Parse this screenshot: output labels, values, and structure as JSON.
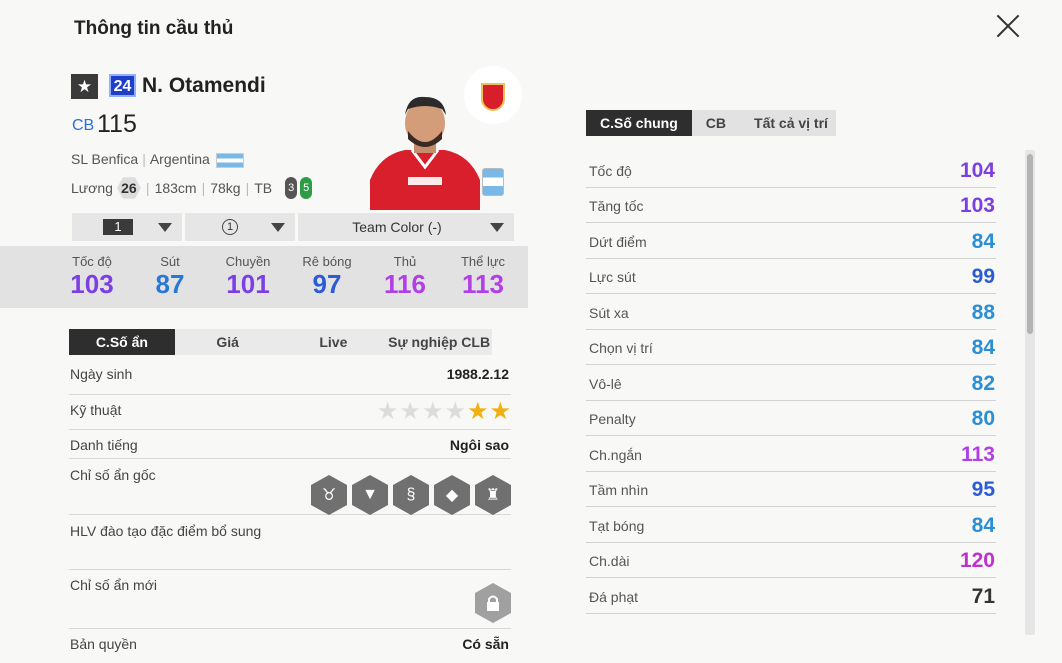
{
  "page_title": "Thông tin cầu thủ",
  "player": {
    "star_icon": "★",
    "season": "24",
    "name": "N. Otamendi",
    "position": "CB",
    "ovr": "115",
    "club": "SL Benfica",
    "nation": "Argentina",
    "wage_label": "Lương",
    "wage": "26",
    "height": "183cm",
    "weight": "78kg",
    "body_type": "TB",
    "left_foot": "3",
    "right_foot": "5"
  },
  "selectors": {
    "upgrade": "1",
    "level": "1",
    "team_color": "Team Color (-)"
  },
  "summary_stats": [
    {
      "label": "Tốc độ",
      "value": "103",
      "color": "#7b3fe4"
    },
    {
      "label": "Sút",
      "value": "87",
      "color": "#2a78d6"
    },
    {
      "label": "Chuyền",
      "value": "101",
      "color": "#7b3fe4"
    },
    {
      "label": "Rê bóng",
      "value": "97",
      "color": "#2a5cd6"
    },
    {
      "label": "Thủ",
      "value": "116",
      "color": "#b040e6"
    },
    {
      "label": "Thể lực",
      "value": "113",
      "color": "#b040e6"
    }
  ],
  "left_tabs": [
    "C.Số ẩn",
    "Giá",
    "Live",
    "Sự nghiệp CLB"
  ],
  "info": {
    "birth_label": "Ngày sinh",
    "birth_value": "1988.2.12",
    "skill_label": "Kỹ thuật",
    "skill_stars": 2,
    "fame_label": "Danh tiếng",
    "fame_value": "Ngôi sao",
    "traits_label": "Chỉ số ẩn gốc",
    "trait_icons": [
      "bull-icon",
      "tie-icon",
      "snake-icon",
      "diamond-icon",
      "trophy-icon"
    ],
    "coach_label": "HLV đào tạo đặc điểm bổ sung",
    "new_traits_label": "Chỉ số ẩn mới",
    "license_label": "Bản quyền",
    "license_value": "Có sẵn"
  },
  "right_tabs": [
    "C.Số chung",
    "CB",
    "Tất cả vị trí"
  ],
  "attributes": [
    {
      "name": "Tốc độ",
      "value": "104",
      "color": "#7b3fe4"
    },
    {
      "name": "Tăng tốc",
      "value": "103",
      "color": "#7b3fe4"
    },
    {
      "name": "Dứt điểm",
      "value": "84",
      "color": "#2a8fd6"
    },
    {
      "name": "Lực sút",
      "value": "99",
      "color": "#2a5cd6"
    },
    {
      "name": "Sút xa",
      "value": "88",
      "color": "#2a8fd6"
    },
    {
      "name": "Chọn vị trí",
      "value": "84",
      "color": "#2a8fd6"
    },
    {
      "name": "Vô-lê",
      "value": "82",
      "color": "#2a8fd6"
    },
    {
      "name": "Penalty",
      "value": "80",
      "color": "#2a8fd6"
    },
    {
      "name": "Ch.ngắn",
      "value": "113",
      "color": "#b040e6"
    },
    {
      "name": "Tầm nhìn",
      "value": "95",
      "color": "#2a5cd6"
    },
    {
      "name": "Tạt bóng",
      "value": "84",
      "color": "#2a8fd6"
    },
    {
      "name": "Ch.dài",
      "value": "120",
      "color": "#c030d0"
    },
    {
      "name": "Đá phạt",
      "value": "71",
      "color": "#333333"
    }
  ]
}
